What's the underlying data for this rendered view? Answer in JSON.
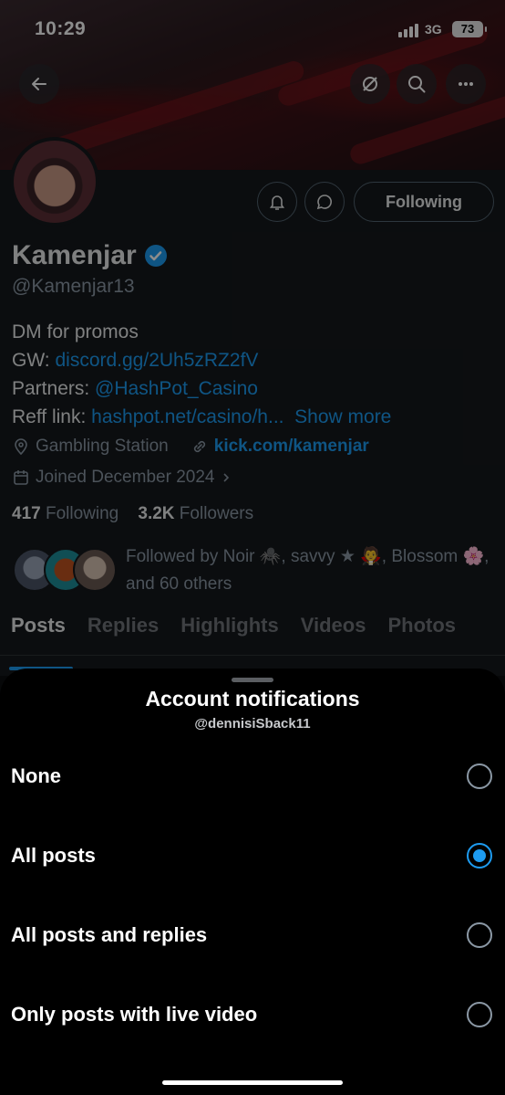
{
  "status_bar": {
    "time": "10:29",
    "network": "3G",
    "battery": "73"
  },
  "profile": {
    "name": "Kamenjar",
    "handle": "@Kamenjar13",
    "following_button": "Following",
    "bio": {
      "line1": "DM for promos",
      "gw_label": "GW:",
      "gw_link": "discord.gg/2Uh5zRZ2fV",
      "partners_label": "Partners:",
      "partners_link": "@HashPot_Casino",
      "reff_label": "Reff link:",
      "reff_link": "hashpot.net/casino/h...",
      "show_more": "Show more"
    },
    "location": "Gambling Station",
    "website": "kick.com/kamenjar",
    "joined": "Joined December 2024",
    "following_count": "417",
    "following_label": "Following",
    "followers_count": "3.2K",
    "followers_label": "Followers",
    "followed_by": "Followed by Noir 🕷️, savvy ★ 🧛, Blossom 🌸, and 60 others",
    "tabs": [
      "Posts",
      "Replies",
      "Highlights",
      "Videos",
      "Photos"
    ]
  },
  "sheet": {
    "title": "Account notifications",
    "subtitle": "@dennisiSback11",
    "options": [
      {
        "label": "None",
        "selected": false
      },
      {
        "label": "All posts",
        "selected": true
      },
      {
        "label": "All posts and replies",
        "selected": false
      },
      {
        "label": "Only posts with live video",
        "selected": false
      }
    ]
  },
  "colors": {
    "accent": "#1d9bf0",
    "sheet_bg": "#000000",
    "verified": "#1d9bf0"
  }
}
